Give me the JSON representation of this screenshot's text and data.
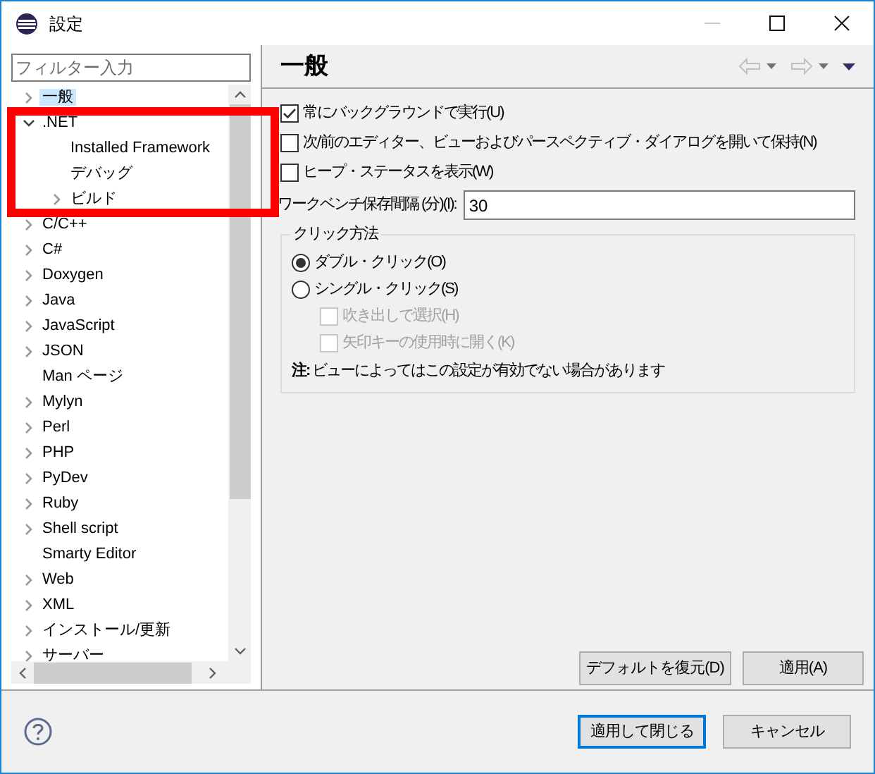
{
  "window": {
    "title": "設定",
    "controls": [
      {
        "kind": "minimize",
        "disabled": true
      },
      {
        "kind": "maximize",
        "disabled": false
      },
      {
        "kind": "close",
        "disabled": false
      }
    ]
  },
  "sidebar": {
    "filter": {
      "placeholder": "フィルター入力"
    },
    "tree": [
      {
        "label": "一般",
        "expandable": true,
        "expanded": false,
        "selected": true
      },
      {
        "label": ".NET",
        "expandable": true,
        "expanded": true,
        "selected": false,
        "children": [
          {
            "label": "Installed Framework",
            "expandable": false,
            "selected": false
          },
          {
            "label": "デバッグ",
            "expandable": false,
            "selected": false
          },
          {
            "label": "ビルド",
            "expandable": true,
            "expanded": false,
            "selected": false
          }
        ]
      },
      {
        "label": "C/C++",
        "expandable": true,
        "expanded": false,
        "selected": false
      },
      {
        "label": "C#",
        "expandable": true,
        "expanded": false,
        "selected": false
      },
      {
        "label": "Doxygen",
        "expandable": true,
        "expanded": false,
        "selected": false
      },
      {
        "label": "Java",
        "expandable": true,
        "expanded": false,
        "selected": false
      },
      {
        "label": "JavaScript",
        "expandable": true,
        "expanded": false,
        "selected": false
      },
      {
        "label": "JSON",
        "expandable": true,
        "expanded": false,
        "selected": false
      },
      {
        "label": "Man ページ",
        "expandable": false,
        "selected": false
      },
      {
        "label": "Mylyn",
        "expandable": true,
        "expanded": false,
        "selected": false
      },
      {
        "label": "Perl",
        "expandable": true,
        "expanded": false,
        "selected": false
      },
      {
        "label": "PHP",
        "expandable": true,
        "expanded": false,
        "selected": false
      },
      {
        "label": "PyDev",
        "expandable": true,
        "expanded": false,
        "selected": false
      },
      {
        "label": "Ruby",
        "expandable": true,
        "expanded": false,
        "selected": false
      },
      {
        "label": "Shell script",
        "expandable": true,
        "expanded": false,
        "selected": false
      },
      {
        "label": "Smarty Editor",
        "expandable": false,
        "selected": false
      },
      {
        "label": "Web",
        "expandable": true,
        "expanded": false,
        "selected": false
      },
      {
        "label": "XML",
        "expandable": true,
        "expanded": false,
        "selected": false
      },
      {
        "label": "インストール/更新",
        "expandable": true,
        "expanded": false,
        "selected": false
      },
      {
        "label": "サーバー",
        "expandable": true,
        "expanded": false,
        "selected": false
      }
    ]
  },
  "page": {
    "title": "一般",
    "settings": [
      {
        "kind": "checkbox",
        "label": "常にバックグラウンドで実行(U)",
        "checked": true
      },
      {
        "kind": "checkbox",
        "label": "次/前のエディター、ビューおよびパースペクティブ・ダイアログを開いて保持(N)",
        "checked": false
      },
      {
        "kind": "checkbox",
        "label": "ヒープ・ステータスを表示(W)",
        "checked": false
      },
      {
        "kind": "field",
        "label": "ワークベンチ保存間隔 (分)(I):",
        "value": "30"
      }
    ],
    "click_group": {
      "title": "クリック方法",
      "options": [
        {
          "kind": "radio",
          "label": "ダブル・クリック(O)",
          "selected": true,
          "disabled": false
        },
        {
          "kind": "radio",
          "label": "シングル・クリック(S)",
          "selected": false,
          "disabled": false
        },
        {
          "kind": "checkbox",
          "label": "吹き出しで選択(H)",
          "checked": false,
          "disabled": true
        },
        {
          "kind": "checkbox",
          "label": "矢印キーの使用時に開く(K)",
          "checked": false,
          "disabled": true
        }
      ],
      "note": "**注:** ビューによってはこの設定が有効でない場合があります"
    },
    "buttons": [
      {
        "label": "デフォルトを復元(D)",
        "default": false
      },
      {
        "label": "適用(A)",
        "default": false
      }
    ]
  },
  "footer": {
    "buttons": [
      {
        "label": "適用して閉じる",
        "default": true
      },
      {
        "label": "キャンセル",
        "default": false
      }
    ]
  }
}
